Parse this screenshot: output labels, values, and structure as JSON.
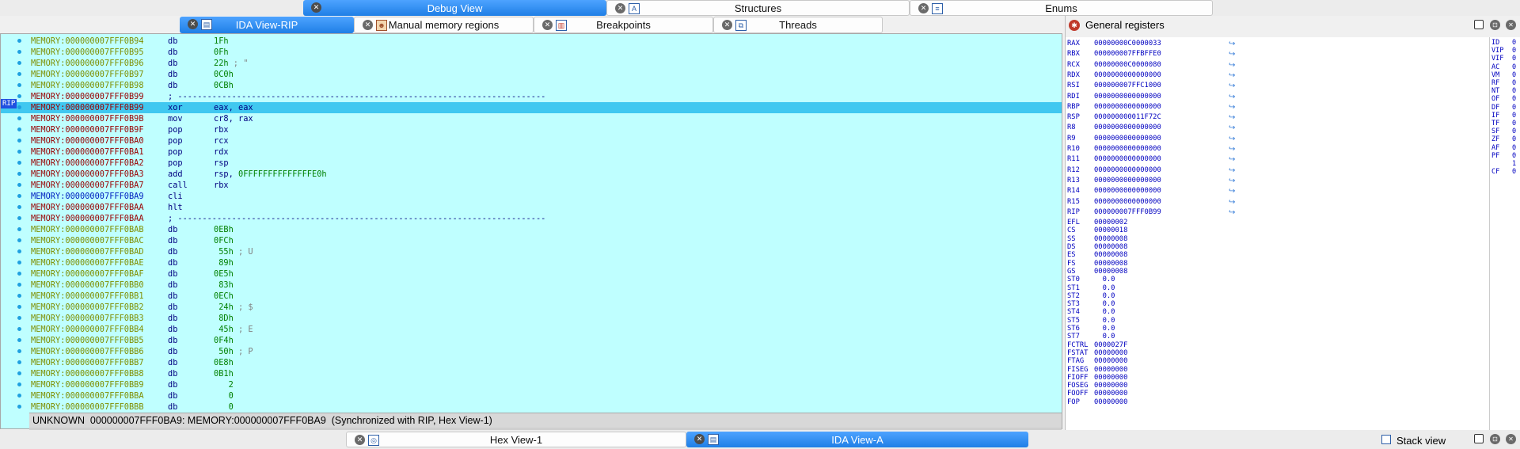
{
  "top_tabs": [
    {
      "label": "Debug View",
      "active": true,
      "icon": "close-icon"
    },
    {
      "label": "Structures",
      "active": false,
      "icon": "structures-icon"
    },
    {
      "label": "Enums",
      "active": false,
      "icon": "enums-icon"
    }
  ],
  "view_tabs": [
    {
      "label": "IDA View-RIP",
      "active": true
    },
    {
      "label": "Manual memory regions",
      "active": false
    },
    {
      "label": "Breakpoints",
      "active": false
    },
    {
      "label": "Threads",
      "active": false
    }
  ],
  "rip_marker": "RIP",
  "disasm_lines": [
    {
      "addr": "MEMORY:000000007FFF0B94",
      "color": "mem",
      "mn": "db",
      "op": "1Fh",
      "num": true,
      "cmt": ""
    },
    {
      "addr": "MEMORY:000000007FFF0B95",
      "color": "mem",
      "mn": "db",
      "op": "0Fh",
      "num": true,
      "cmt": ""
    },
    {
      "addr": "MEMORY:000000007FFF0B96",
      "color": "mem",
      "mn": "db",
      "op": "22h",
      "num": true,
      "cmt": " ; \""
    },
    {
      "addr": "MEMORY:000000007FFF0B97",
      "color": "mem",
      "mn": "db",
      "op": "0C0h",
      "num": true,
      "cmt": ""
    },
    {
      "addr": "MEMORY:000000007FFF0B98",
      "color": "mem",
      "mn": "db",
      "op": "0CBh",
      "num": true,
      "cmt": ""
    },
    {
      "addr": "MEMORY:000000007FFF0B99",
      "color": "mem-red",
      "mn": "",
      "op": "",
      "num": false,
      "cmt": "",
      "sep": "; ---------------------------------------------------------------------------"
    },
    {
      "addr": "MEMORY:000000007FFF0B99",
      "color": "mem-red",
      "mn": "xor",
      "op": "eax, eax",
      "num": false,
      "cmt": "",
      "hl": true
    },
    {
      "addr": "MEMORY:000000007FFF0B9B",
      "color": "mem-red",
      "mn": "mov",
      "op": "cr8, rax",
      "num": false,
      "cmt": ""
    },
    {
      "addr": "MEMORY:000000007FFF0B9F",
      "color": "mem-red",
      "mn": "pop",
      "op": "rbx",
      "num": false,
      "cmt": ""
    },
    {
      "addr": "MEMORY:000000007FFF0BA0",
      "color": "mem-red",
      "mn": "pop",
      "op": "rcx",
      "num": false,
      "cmt": ""
    },
    {
      "addr": "MEMORY:000000007FFF0BA1",
      "color": "mem-red",
      "mn": "pop",
      "op": "rdx",
      "num": false,
      "cmt": ""
    },
    {
      "addr": "MEMORY:000000007FFF0BA2",
      "color": "mem-red",
      "mn": "pop",
      "op": "rsp",
      "num": false,
      "cmt": ""
    },
    {
      "addr": "MEMORY:000000007FFF0BA3",
      "color": "mem-red",
      "mn": "add",
      "op": "rsp, ",
      "num": false,
      "cmt": "",
      "op2": "0FFFFFFFFFFFFFFE0h"
    },
    {
      "addr": "MEMORY:000000007FFF0BA7",
      "color": "mem-red",
      "mn": "call",
      "op": "rbx",
      "num": false,
      "cmt": ""
    },
    {
      "addr": "MEMORY:000000007FFF0BA9",
      "color": "mem-blue",
      "mn": "cli",
      "op": "",
      "num": false,
      "cmt": ""
    },
    {
      "addr": "MEMORY:000000007FFF0BAA",
      "color": "mem-red",
      "mn": "hlt",
      "op": "",
      "num": false,
      "cmt": ""
    },
    {
      "addr": "MEMORY:000000007FFF0BAA",
      "color": "mem-red",
      "mn": "",
      "op": "",
      "num": false,
      "cmt": "",
      "sep": "; ---------------------------------------------------------------------------"
    },
    {
      "addr": "MEMORY:000000007FFF0BAB",
      "color": "mem",
      "mn": "db",
      "op": "0EBh",
      "num": true,
      "cmt": ""
    },
    {
      "addr": "MEMORY:000000007FFF0BAC",
      "color": "mem",
      "mn": "db",
      "op": "0FCh",
      "num": true,
      "cmt": ""
    },
    {
      "addr": "MEMORY:000000007FFF0BAD",
      "color": "mem",
      "mn": "db",
      "op": " 55h",
      "num": true,
      "cmt": " ; U"
    },
    {
      "addr": "MEMORY:000000007FFF0BAE",
      "color": "mem",
      "mn": "db",
      "op": " 89h",
      "num": true,
      "cmt": ""
    },
    {
      "addr": "MEMORY:000000007FFF0BAF",
      "color": "mem",
      "mn": "db",
      "op": "0E5h",
      "num": true,
      "cmt": ""
    },
    {
      "addr": "MEMORY:000000007FFF0BB0",
      "color": "mem",
      "mn": "db",
      "op": " 83h",
      "num": true,
      "cmt": ""
    },
    {
      "addr": "MEMORY:000000007FFF0BB1",
      "color": "mem",
      "mn": "db",
      "op": "0ECh",
      "num": true,
      "cmt": ""
    },
    {
      "addr": "MEMORY:000000007FFF0BB2",
      "color": "mem",
      "mn": "db",
      "op": " 24h",
      "num": true,
      "cmt": " ; $"
    },
    {
      "addr": "MEMORY:000000007FFF0BB3",
      "color": "mem",
      "mn": "db",
      "op": " 8Dh",
      "num": true,
      "cmt": ""
    },
    {
      "addr": "MEMORY:000000007FFF0BB4",
      "color": "mem",
      "mn": "db",
      "op": " 45h",
      "num": true,
      "cmt": " ; E"
    },
    {
      "addr": "MEMORY:000000007FFF0BB5",
      "color": "mem",
      "mn": "db",
      "op": "0F4h",
      "num": true,
      "cmt": ""
    },
    {
      "addr": "MEMORY:000000007FFF0BB6",
      "color": "mem",
      "mn": "db",
      "op": " 50h",
      "num": true,
      "cmt": " ; P"
    },
    {
      "addr": "MEMORY:000000007FFF0BB7",
      "color": "mem",
      "mn": "db",
      "op": "0E8h",
      "num": true,
      "cmt": ""
    },
    {
      "addr": "MEMORY:000000007FFF0BB8",
      "color": "mem",
      "mn": "db",
      "op": "0B1h",
      "num": true,
      "cmt": ""
    },
    {
      "addr": "MEMORY:000000007FFF0BB9",
      "color": "mem",
      "mn": "db",
      "op": "   2",
      "num": true,
      "cmt": ""
    },
    {
      "addr": "MEMORY:000000007FFF0BBA",
      "color": "mem",
      "mn": "db",
      "op": "   0",
      "num": true,
      "cmt": ""
    },
    {
      "addr": "MEMORY:000000007FFF0BBB",
      "color": "mem",
      "mn": "db",
      "op": "   0",
      "num": true,
      "cmt": ""
    }
  ],
  "status_text": "UNKNOWN  000000007FFF0BA9: MEMORY:000000007FFF0BA9  (Synchronized with RIP, Hex View-1)",
  "registers_panel": {
    "title": "General registers",
    "registers": [
      {
        "name": "RAX",
        "value": "00000000C0000033",
        "jump": true
      },
      {
        "name": "RBX",
        "value": "000000007FFBFFE0",
        "jump": true
      },
      {
        "name": "RCX",
        "value": "00000000C0000080",
        "jump": true
      },
      {
        "name": "RDX",
        "value": "0000000000000000",
        "jump": true
      },
      {
        "name": "RSI",
        "value": "000000007FFC1000",
        "jump": true
      },
      {
        "name": "RDI",
        "value": "0000000000000000",
        "jump": true
      },
      {
        "name": "RBP",
        "value": "0000000000000000",
        "jump": true
      },
      {
        "name": "RSP",
        "value": "000000000011F72C",
        "jump": true
      },
      {
        "name": "R8",
        "value": "0000000000000000",
        "jump": true
      },
      {
        "name": "R9",
        "value": "0000000000000000",
        "jump": true
      },
      {
        "name": "R10",
        "value": "0000000000000000",
        "jump": true
      },
      {
        "name": "R11",
        "value": "0000000000000000",
        "jump": true
      },
      {
        "name": "R12",
        "value": "0000000000000000",
        "jump": true
      },
      {
        "name": "R13",
        "value": "0000000000000000",
        "jump": true
      },
      {
        "name": "R14",
        "value": "0000000000000000",
        "jump": true
      },
      {
        "name": "R15",
        "value": "0000000000000000",
        "jump": true
      },
      {
        "name": "RIP",
        "value": "000000007FFF0B99",
        "jump": true
      },
      {
        "name": "EFL",
        "value": "00000002",
        "jump": false
      },
      {
        "name": "CS",
        "value": "00000018",
        "jump": false
      },
      {
        "name": "SS",
        "value": "00000008",
        "jump": false
      },
      {
        "name": "DS",
        "value": "00000008",
        "jump": false
      },
      {
        "name": "ES",
        "value": "00000008",
        "jump": false
      },
      {
        "name": "FS",
        "value": "00000008",
        "jump": false
      },
      {
        "name": "GS",
        "value": "00000008",
        "jump": false
      },
      {
        "name": "ST0",
        "value": "  0.0",
        "jump": false
      },
      {
        "name": "ST1",
        "value": "  0.0",
        "jump": false
      },
      {
        "name": "ST2",
        "value": "  0.0",
        "jump": false
      },
      {
        "name": "ST3",
        "value": "  0.0",
        "jump": false
      },
      {
        "name": "ST4",
        "value": "  0.0",
        "jump": false
      },
      {
        "name": "ST5",
        "value": "  0.0",
        "jump": false
      },
      {
        "name": "ST6",
        "value": "  0.0",
        "jump": false
      },
      {
        "name": "ST7",
        "value": "  0.0",
        "jump": false
      },
      {
        "name": "FCTRL",
        "value": "0000027F",
        "jump": false
      },
      {
        "name": "FSTAT",
        "value": "00000000",
        "jump": false
      },
      {
        "name": "FTAG",
        "value": "00000000",
        "jump": false
      },
      {
        "name": "FISEG",
        "value": "00000000",
        "jump": false
      },
      {
        "name": "FIOFF",
        "value": "00000000",
        "jump": false
      },
      {
        "name": "FOSEG",
        "value": "00000000",
        "jump": false
      },
      {
        "name": "FOOFF",
        "value": "00000000",
        "jump": false
      },
      {
        "name": "FOP",
        "value": "00000000",
        "jump": false
      }
    ],
    "flags": [
      {
        "name": "ID",
        "value": "0"
      },
      {
        "name": "VIP",
        "value": "0"
      },
      {
        "name": "VIF",
        "value": "0"
      },
      {
        "name": "AC",
        "value": "0"
      },
      {
        "name": "VM",
        "value": "0"
      },
      {
        "name": "RF",
        "value": "0"
      },
      {
        "name": "NT",
        "value": "0"
      },
      {
        "name": "OF",
        "value": "0"
      },
      {
        "name": "DF",
        "value": "0"
      },
      {
        "name": "IF",
        "value": "0"
      },
      {
        "name": "TF",
        "value": "0"
      },
      {
        "name": "SF",
        "value": "0"
      },
      {
        "name": "ZF",
        "value": "0"
      },
      {
        "name": "AF",
        "value": "0"
      },
      {
        "name": "PF",
        "value": "0"
      },
      {
        "name": "",
        "value": "1"
      },
      {
        "name": "CF",
        "value": "0"
      }
    ]
  },
  "bottom_tabs": [
    {
      "label": "Hex View-1",
      "active": false
    },
    {
      "label": "IDA View-A",
      "active": true
    }
  ],
  "stack_view": {
    "title": "Stack view"
  }
}
